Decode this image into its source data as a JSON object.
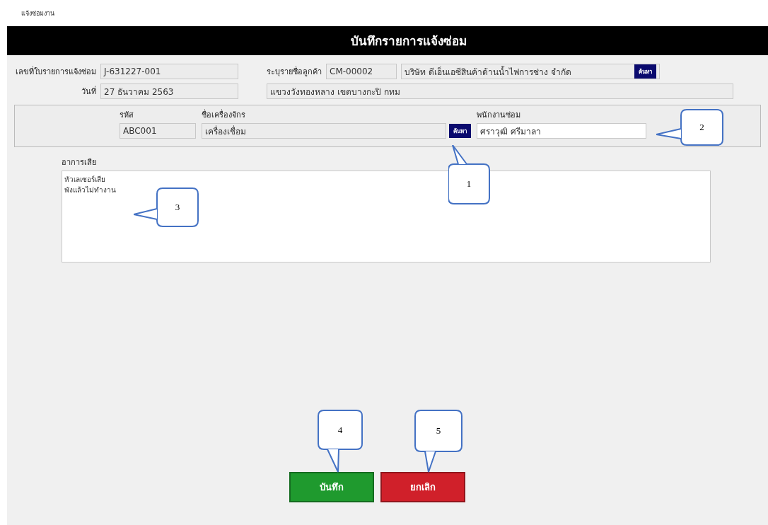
{
  "window": {
    "title": "แจ้งซ่อมงาน"
  },
  "header": {
    "title": "บันทึกรายการแจ้งซ่อม"
  },
  "repair": {
    "number_label": "เลขที่ใบรายการแจ้งซ่อม",
    "number": "J-631227-001",
    "date_label": "วันที่",
    "date": "27 ธันวาคม 2563"
  },
  "customer": {
    "label": "ระบุรายชื่อลูกค้า",
    "code": "CM-00002",
    "name": "บริษัท ดีเอ็นเอซีสินค้าด้านน้ำไฟการช่าง จำกัด",
    "search_button": "ค้นหา",
    "address": "แขวงวังทองหลาง เขตบางกะปิ กทม"
  },
  "machine": {
    "code_label": "รหัส",
    "code": "ABC001",
    "name_label": "ชื่อเครื่องจักร",
    "name": "เครื่องเชื่อม",
    "search_button": "ค้นหา",
    "staff_label": "พนักงานซ่อม",
    "staff": "ศราวุฒิ ศรีมาลา"
  },
  "symptom": {
    "label": "อาการเสีย",
    "lines": [
      "หัวเลเซอร์เสีย",
      "พังแล้วไม่ทำงาน"
    ]
  },
  "buttons": [
    {
      "label": "บันทึก",
      "kind": "save"
    },
    {
      "label": "ยกเลิก",
      "kind": "cancel"
    }
  ],
  "callouts": [
    "1",
    "2",
    "3",
    "4",
    "5"
  ]
}
